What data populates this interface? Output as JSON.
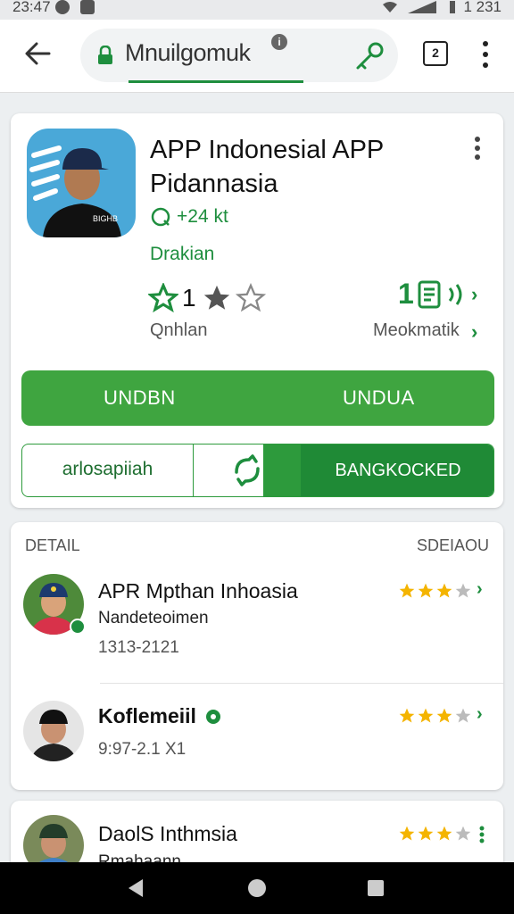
{
  "status_bar": {
    "time": "23:47",
    "right_time": "1 231"
  },
  "browser": {
    "url": "Mnuilgomuk",
    "tabs_count": "2"
  },
  "app": {
    "name": "APP Indonesial APP Pidannasia",
    "meta_text": "+24 kt",
    "developer": "Drakian",
    "rating_value": "1",
    "rating_label": "Qnhlan",
    "downloads_value": "1",
    "downloads_label": "Meokmatik",
    "install_left": "UNDBN",
    "install_right": "UNDUA",
    "outline_button": "arlosapiiah",
    "primary_button": "BANGKOCKED"
  },
  "reviews_section": {
    "header_left": "DETAIL",
    "header_right": "SDEIAOU",
    "items": [
      {
        "name": "APR Mpthan Inhoasia",
        "subtitle": "Nandeteoimen",
        "date": "1313-2121",
        "rating": 3.5
      },
      {
        "name": "Koflemeiil",
        "subtitle": "",
        "date": "9:97-2.1 X1",
        "rating": 3.5
      }
    ]
  },
  "bottom_card": {
    "name": "DaolS Inthmsia",
    "subtitle": "Rmahaann",
    "rating": 3.5
  },
  "colors": {
    "brand_green": "#1e8e3e",
    "install_green": "#3fa540",
    "star_gold": "#f4b400"
  }
}
